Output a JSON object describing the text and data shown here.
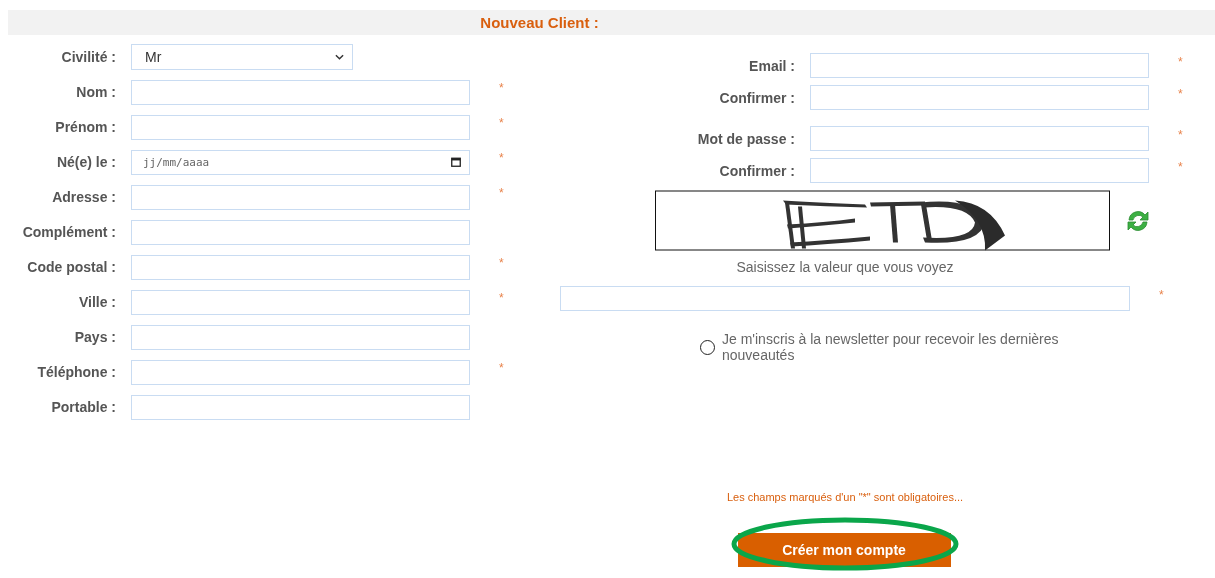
{
  "header": {
    "title": "Nouveau Client :"
  },
  "left_fields": [
    {
      "label": "Civilité :",
      "kind": "select",
      "value": "Mr"
    },
    {
      "label": "Nom :",
      "kind": "text",
      "marker": "*"
    },
    {
      "label": "Prénom :",
      "kind": "text",
      "marker": "*"
    },
    {
      "label": "Né(e) le :",
      "kind": "date",
      "placeholder": "jj/mm/aaaa",
      "marker": "*"
    },
    {
      "label": "Adresse :",
      "kind": "text",
      "marker": "*"
    },
    {
      "label": "Complément :",
      "kind": "text"
    },
    {
      "label": "Code postal :",
      "kind": "text",
      "marker": "*"
    },
    {
      "label": "Ville :",
      "kind": "text",
      "marker": "*"
    },
    {
      "label": "Pays :",
      "kind": "text"
    },
    {
      "label": "Téléphone :",
      "kind": "text",
      "marker": "*"
    },
    {
      "label": "Portable :",
      "kind": "text"
    }
  ],
  "right_groups": [
    [
      {
        "label": "Email :",
        "marker": "*"
      },
      {
        "label": "Confirmer :",
        "marker": "*"
      }
    ],
    [
      {
        "label": "Mot de passe :",
        "marker": "*"
      },
      {
        "label": "Confirmer :",
        "marker": "*"
      }
    ]
  ],
  "captcha": {
    "caption": "Saisissez la valeur que vous voyez",
    "marker": "*"
  },
  "newsletter": {
    "label": "Je m'inscris à la newsletter pour recevoir les dernières nouveautés",
    "checked": false
  },
  "note": "Les champs marqués d'un \"*\" sont obligatoires...",
  "submit": {
    "label": "Créer mon compte",
    "highlighted": true
  }
}
